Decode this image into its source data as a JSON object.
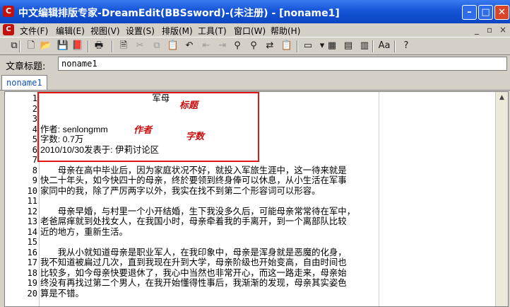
{
  "window": {
    "title": "中文编辑排版专家-DreamEdit(BBSsword)-(未注册) - [noname1]",
    "min_label": "–",
    "max_label": "□",
    "close_label": "✕"
  },
  "menu": {
    "items": [
      "文件(F)",
      "编辑(E)",
      "视图(V)",
      "设置(S)",
      "排版(M)",
      "工具(T)",
      "窗口(W)",
      "帮助(H)"
    ],
    "mdi": [
      "_",
      "▫",
      "×"
    ]
  },
  "toolbar": {
    "icons": [
      "copy-icon",
      "new-file-icon",
      "open-folder-icon",
      "save-icon",
      "book-icon",
      "print-icon",
      "page-icon",
      "cut-icon",
      "copy2-icon",
      "paste-icon",
      "undo-icon",
      "indent-icon",
      "outdent-icon",
      "find-icon",
      "find-next-icon",
      "replace-icon",
      "clipboard-icon",
      "view-icon",
      "dropdown-icon",
      "screen-icon",
      "layout-icon",
      "columns-icon",
      "font-icon",
      "help-icon"
    ],
    "glyphs": [
      "⧉",
      "🗋",
      "📂",
      "💾",
      "📕",
      "🖶",
      "🗎",
      "✂",
      "⧉",
      "📋",
      "↶",
      "⇤",
      "⇥",
      "⚲",
      "⚲",
      "⇄",
      "📋",
      "▭",
      "▾",
      "▦",
      "▤",
      "▥",
      "Aa",
      "?"
    ],
    "disabled": [
      false,
      false,
      false,
      false,
      false,
      false,
      false,
      true,
      true,
      false,
      false,
      true,
      true,
      false,
      false,
      false,
      false,
      false,
      false,
      false,
      false,
      false,
      false,
      false
    ]
  },
  "title_field": {
    "label": "文章标题:",
    "value": "noname1"
  },
  "tab": {
    "label": "noname1"
  },
  "editor": {
    "line_numbers": [
      "1",
      "2",
      "3",
      "4",
      "5",
      "6",
      "7",
      "8",
      "9",
      "10",
      "11",
      "12",
      "13",
      "14",
      "15",
      "16",
      "17",
      "18",
      "19",
      "20"
    ],
    "lines": [
      "                                              军母",
      "",
      "",
      "作者: senlongmm",
      "字数: 0.7万",
      "2010/10/30发表于: 伊莉讨论区",
      "",
      "　　母亲在高中毕业后，因为家庭状况不好，就投入军旅生涯中，这一待来就是",
      "快二十年头，如今快四十的母亲，终於要领到终身俸可以休息，从小生活在军事",
      "家同中的我，除了严厉两字以外，我实在找不到第二个形容词可以形容。",
      "",
      "　　母亲早婚，与村里一个小开结婚，生下我没多久后，可能母亲常常待在军中，",
      "老爸屌痒就到处找女人，在我国小时，母亲牵着我的手离开，到一个离部队比较",
      "近的地方，重新生活。",
      "",
      "　　我从小就知道母亲是职业军人，在我印象中，母亲是浑身就是恶魔的化身，",
      "我不知道被扁过几次，直到我现在升到大学，母亲阶级也开始变高，自由时间也",
      "比较多，如今母亲快要退休了，我心中当然也非常开心，而这一路走来，母亲始",
      "终没有再找过第二个男人，在我开始懂得性事后，我渐渐的发现，母亲其实姿色",
      "算是不错。"
    ],
    "annotations": {
      "title": "标题",
      "author": "作者",
      "wordcount": "字数"
    }
  }
}
